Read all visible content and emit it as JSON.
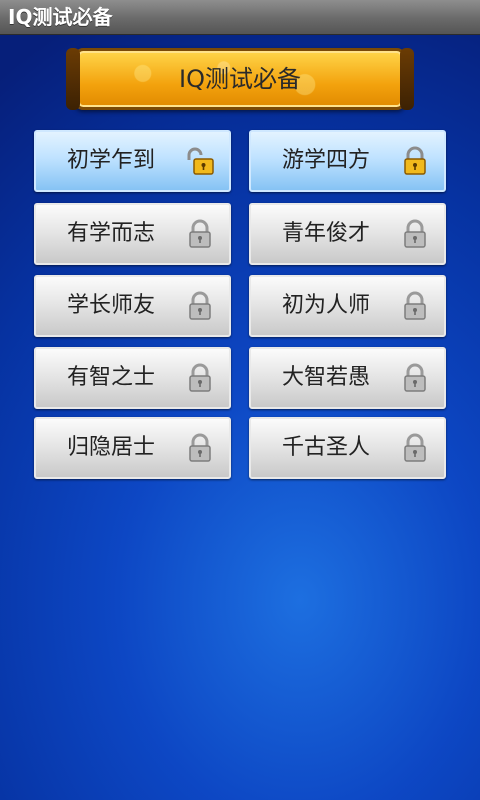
{
  "window": {
    "title": "IQ测试必备"
  },
  "banner": {
    "title": "IQ测试必备"
  },
  "levels": [
    {
      "label": "初学乍到",
      "status": "unlocked"
    },
    {
      "label": "游学四方",
      "status": "unlocked"
    },
    {
      "label": "有学而志",
      "status": "locked"
    },
    {
      "label": "青年俊才",
      "status": "locked"
    },
    {
      "label": "学长师友",
      "status": "locked"
    },
    {
      "label": "初为人师",
      "status": "locked"
    },
    {
      "label": "有智之士",
      "status": "locked"
    },
    {
      "label": "大智若愚",
      "status": "locked"
    },
    {
      "label": "归隐居士",
      "status": "locked"
    },
    {
      "label": "千古圣人",
      "status": "locked"
    }
  ],
  "colors": {
    "background_blue": "#0d47c4",
    "banner_gold": "#f3a20d",
    "unlocked_button": "#bfe2ff",
    "locked_button": "#e6e6e6"
  }
}
